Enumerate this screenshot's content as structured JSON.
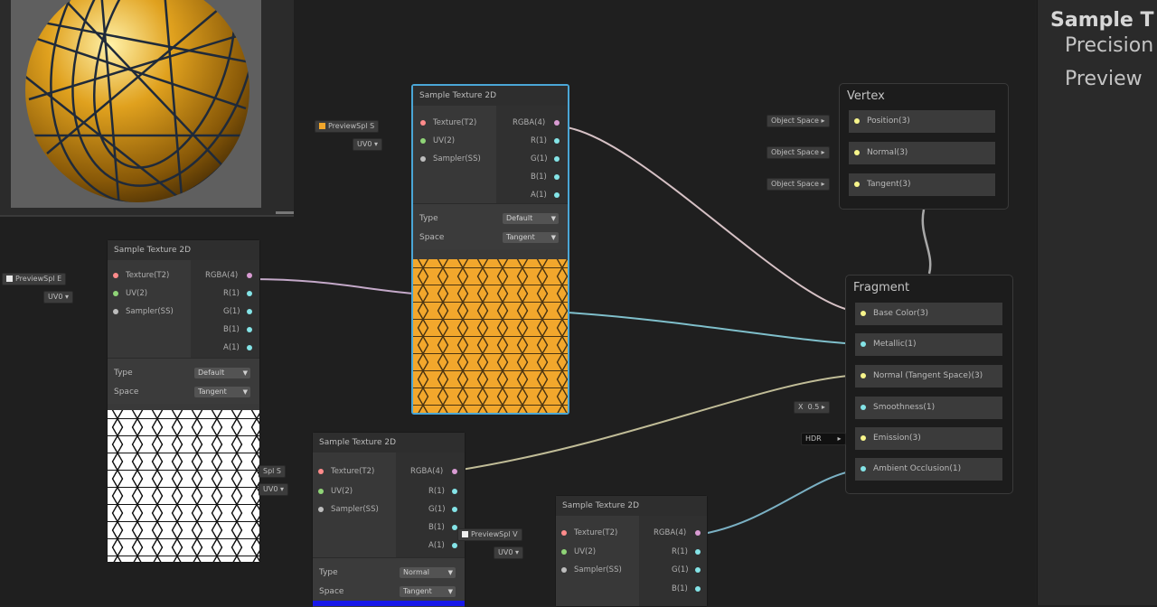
{
  "inspector": {
    "title": "Sample T",
    "field1": "Precision",
    "field2": "Preview"
  },
  "node_title": "Sample Texture 2D",
  "ports": {
    "texture": "Texture(T2)",
    "uv": "UV(2)",
    "sampler": "Sampler(SS)",
    "rgba": "RGBA(4)",
    "r": "R(1)",
    "g": "G(1)",
    "b": "B(1)",
    "a": "A(1)"
  },
  "props": {
    "type_label": "Type",
    "space_label": "Space"
  },
  "node_values": {
    "top": {
      "type": "Default",
      "space": "Tangent"
    },
    "left": {
      "type": "Default",
      "space": "Tangent"
    },
    "mid": {
      "type": "Normal",
      "space": "Tangent"
    }
  },
  "input_chips": {
    "preview_top": "PreviewSpl  S",
    "preview_left": "PreviewSpl  E",
    "preview_mid": "Spl  S",
    "preview_br": "PreviewSpl  V",
    "uv0": "UV0"
  },
  "vertex": {
    "title": "Vertex",
    "slots": [
      "Position(3)",
      "Normal(3)",
      "Tangent(3)"
    ],
    "chips": [
      "Object Space",
      "Object Space",
      "Object Space"
    ]
  },
  "fragment": {
    "title": "Fragment",
    "slots": [
      "Base Color(3)",
      "Metallic(1)",
      "Normal (Tangent Space)(3)",
      "Smoothness(1)",
      "Emission(3)",
      "Ambient Occlusion(1)"
    ],
    "smoothness_x": "X",
    "smoothness_value": "0.5",
    "emission_mode": "HDR"
  },
  "colors": {
    "rgba_port": "#d99bd3",
    "vec1_port": "#84e4e7",
    "vec2_port": "#8fd477",
    "vec3_port": "#f7f58b",
    "tex_port": "#ff8b8b",
    "selection": "#4aa6d6"
  }
}
